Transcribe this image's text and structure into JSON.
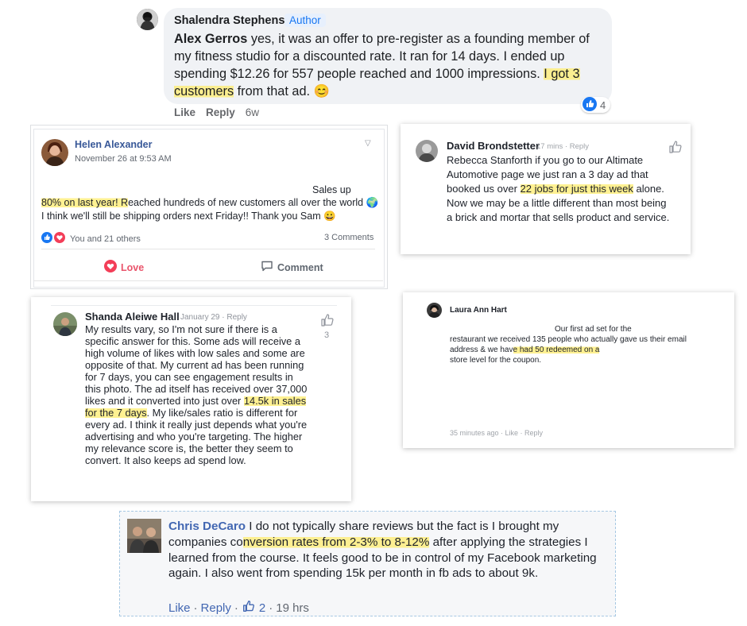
{
  "card1": {
    "name": "Shalendra Stephens",
    "badge": "Author",
    "mention": "Alex Gerros",
    "text_before": " yes, it was an offer to pre-register as a founding member of my fitness studio for a discounted rate. It ran for 14 days. I ended up spending $12.26 for 557 people reached and 1000 impressions. ",
    "highlight": "I got 3 customers",
    "text_after": " from that ad. 😊",
    "reaction_count": "4",
    "like": "Like",
    "reply": "Reply",
    "time": "6w"
  },
  "card2": {
    "name": "Helen Alexander",
    "date": "November 26 at 9:53 AM",
    "sales_up": "Sales up",
    "highlight": "80% on last year! R",
    "text_after": "eached hundreds of new customers all over the world 🌍 I think we'll still be shipping orders next Friday!! Thank you Sam 😀",
    "reactions": "You and 21 others",
    "comments": "3 Comments",
    "love": "Love",
    "comment": "Comment"
  },
  "card3": {
    "name": "David Brondstetter",
    "meta": "17 mins · Reply",
    "mention": "Rebecca Stanforth",
    "text_mid": " if you go to our ",
    "page_name": "Altimate Automotive",
    "text_before_hl": " page we just ran a 3 day ad that booked us over ",
    "highlight": "22 jobs for just this week",
    "text_after": " alone. Now we may be a little different than most being a brick and mortar that sells product and service."
  },
  "card4": {
    "name": "Shanda Aleiwe Hall",
    "meta": "January 29 · Reply",
    "text_before": "My results vary, so I'm not sure if there is a specific answer for this. Some ads will receive a high volume of likes with low sales and some are opposite of that. My current ad has been running for 7 days, you can see engagement results in this photo. The ad itself has received over 37,000 likes and it converted into just over ",
    "highlight": "14.5k in sales for the 7 days",
    "text_after": ". My like/sales ratio is different for every ad. I think it really just depends what you're advertising and who you're targeting. The higher my relevance score is, the better they seem to convert. It also keeps ad spend low.",
    "like_count": "3"
  },
  "card5": {
    "name": "Laura Ann Hart",
    "lead": "Our first ad set for the",
    "text_before": "restaurant we received 135 people who actually gave us their email address & we hav",
    "highlight": "e had 50 redeemed on a",
    "text_after": "store level for the coupon.",
    "meta": "35 minutes ago · Like · Reply"
  },
  "card6": {
    "name": "Chris DeCaro",
    "text_before": " I do not typically share reviews but the fact is I brought my companies co",
    "highlight": "nversion rates from 2-3% to 8-12%",
    "text_after": " after applying the strategies I learned from the course. It feels good to be in control of my Facebook marketing again. I also went from spending 15k per month in fb ads to about 9k.",
    "like": "Like",
    "reply": "Reply",
    "like_count": "2",
    "time": "19 hrs"
  },
  "colors": {
    "highlight": "#ffec6e",
    "fb_blue": "#1877f2",
    "link_blue": "#385898",
    "love_red": "#e9546b"
  }
}
